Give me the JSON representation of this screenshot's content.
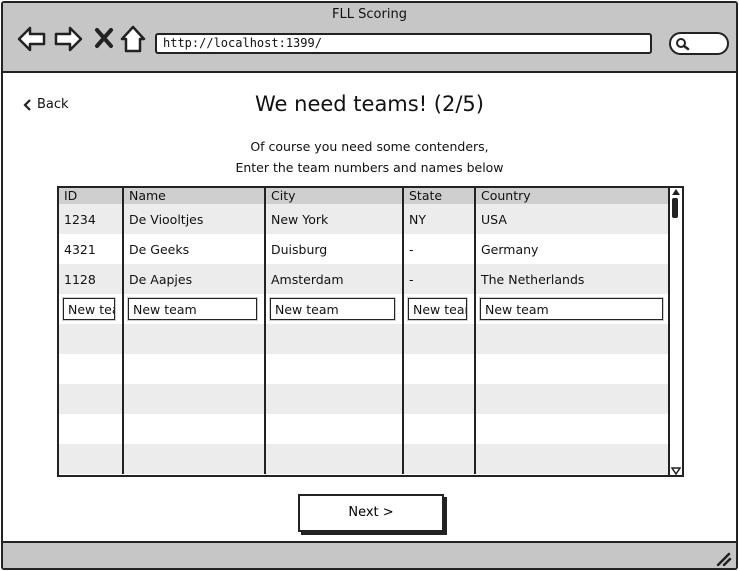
{
  "window": {
    "title": "FLL Scoring",
    "url": "http://localhost:1399/"
  },
  "nav_icons": [
    "back-arrow-icon",
    "forward-arrow-icon",
    "close-x-icon",
    "home-icon"
  ],
  "back_link": {
    "label": "Back"
  },
  "page": {
    "title": "We need teams! (2/5)",
    "subtitle_line1": "Of course you need some contenders,",
    "subtitle_line2": "Enter the team numbers and names below"
  },
  "table": {
    "columns": [
      "ID",
      "Name",
      "City",
      "State",
      "Country"
    ],
    "rows": [
      [
        "1234",
        "De Viooltjes",
        "New York",
        "NY",
        "USA"
      ],
      [
        "4321",
        "De Geeks",
        "Duisburg",
        "-",
        "Germany"
      ],
      [
        "1128",
        "De Aapjes",
        "Amsterdam",
        "-",
        "The Netherlands"
      ]
    ],
    "new_row_values": [
      "New team",
      "New team",
      "New team",
      "New team",
      "New team"
    ]
  },
  "next_button": {
    "label": "Next >"
  }
}
